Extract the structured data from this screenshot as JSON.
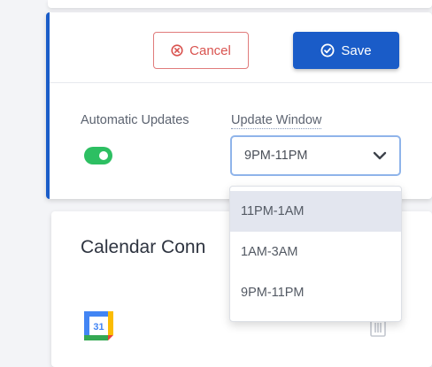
{
  "header": {
    "cancel_label": "Cancel",
    "save_label": "Save"
  },
  "settings": {
    "auto_updates_label": "Automatic Updates",
    "auto_updates_enabled": true,
    "update_window_label": "Update Window",
    "update_window_value": "9PM-11PM"
  },
  "dropdown": {
    "options": [
      "11PM-1AM",
      "1AM-3AM",
      "9PM-11PM"
    ],
    "highlighted_option": "11PM-1AM"
  },
  "calendar": {
    "title": "Calendar Conn",
    "icon_text": "31"
  },
  "colors": {
    "accent": "#1a5cc8",
    "cancel": "#d9534f",
    "toggle_on": "#2dbf62"
  },
  "icons": [
    "cancel-circle-icon",
    "check-circle-icon",
    "chevron-down-icon",
    "google-calendar-icon",
    "trash-icon"
  ]
}
